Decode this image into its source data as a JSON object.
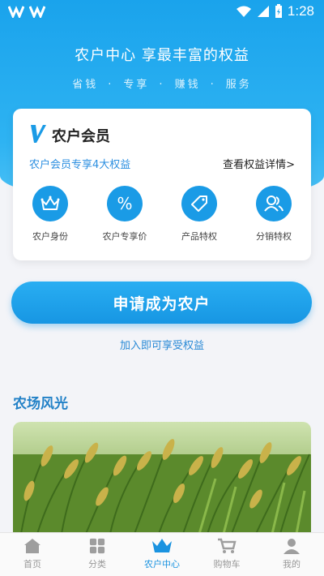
{
  "status_bar": {
    "time": "1:28"
  },
  "hero": {
    "title": "农户中心 享最丰富的权益",
    "tags": [
      "省钱",
      "专享",
      "赚钱",
      "服务"
    ]
  },
  "member_card": {
    "title": "农户会员",
    "desc": "农户会员专享4大权益",
    "link": "查看权益详情>",
    "benefits": [
      {
        "label": "农户身份",
        "icon": "crown-icon"
      },
      {
        "label": "农户专享价",
        "icon": "percent-icon"
      },
      {
        "label": "产品特权",
        "icon": "tag-icon"
      },
      {
        "label": "分销特权",
        "icon": "users-icon"
      }
    ]
  },
  "apply": {
    "button_label": "申请成为农户",
    "note": "加入即可享受权益"
  },
  "farm": {
    "title": "农场风光"
  },
  "tabbar": {
    "tabs": [
      {
        "label": "首页",
        "icon": "home-icon"
      },
      {
        "label": "分类",
        "icon": "grid-icon"
      },
      {
        "label": "农户中心",
        "icon": "crown-icon",
        "active": true
      },
      {
        "label": "购物车",
        "icon": "cart-icon"
      },
      {
        "label": "我的",
        "icon": "user-icon"
      }
    ]
  },
  "colors": {
    "primary": "#1a9be6",
    "inactive": "#999999"
  }
}
